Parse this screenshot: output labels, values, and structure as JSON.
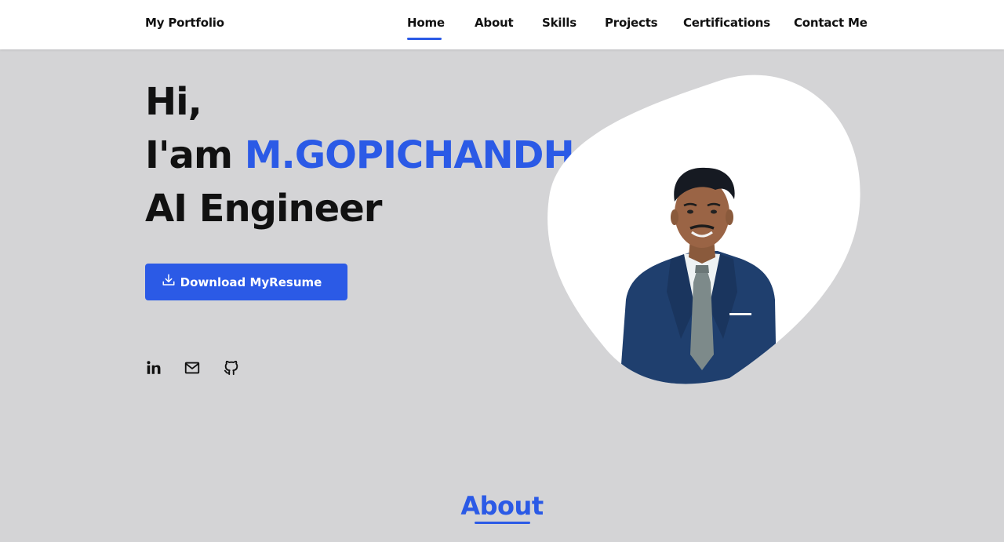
{
  "nav": {
    "brand": "My Portfolio",
    "links": [
      "Home",
      "About",
      "Skills",
      "Projects",
      "Certifications",
      "Contact Me"
    ],
    "active": "Home"
  },
  "hero": {
    "greeting": "Hi,",
    "intro_prefix": "I'am",
    "name": "M.GOPICHANDH",
    "role": "AI Engineer",
    "resume_button": "Download MyResume",
    "socials": [
      "linkedin-icon",
      "mail-icon",
      "github-icon"
    ]
  },
  "about": {
    "heading": "About"
  },
  "colors": {
    "accent": "#2b5ae6",
    "background": "#d4d4d6",
    "text": "#111111",
    "navbar": "#ffffff"
  }
}
